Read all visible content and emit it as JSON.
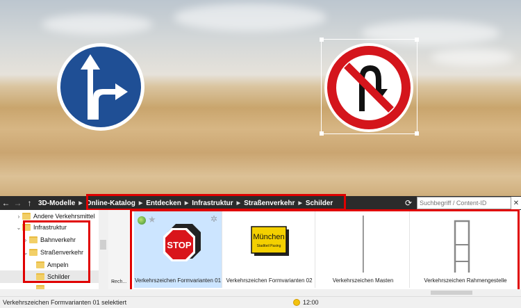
{
  "toolbar": {
    "root_label": "3D-Modelle",
    "breadcrumbs": [
      "Online-Katalog",
      "Entdecken",
      "Infrastruktur",
      "Straßenverkehr",
      "Schilder"
    ],
    "search_placeholder": "Suchbegriff / Content-ID"
  },
  "tree": {
    "items": [
      {
        "label": "Andere Verkehrsmittel",
        "expanded": false
      },
      {
        "label": "Infrastruktur",
        "expanded": true
      },
      {
        "label": "Bahnverkehr",
        "expanded": false
      },
      {
        "label": "Straßenverkehr",
        "expanded": true
      },
      {
        "label": "Ampeln",
        "expanded": false
      },
      {
        "label": "Schilder",
        "selected": true
      },
      {
        "label": "..."
      }
    ],
    "column_label": "Rech..."
  },
  "catalog": {
    "items": [
      {
        "label": "Verkehrszeichen Formvarianten 01",
        "icon": "stop-sign-icon",
        "selected": true
      },
      {
        "label": "Verkehrszeichen Formvarianten 02",
        "icon": "town-sign-icon",
        "sign_text_1": "München",
        "sign_text_2": "Stadtteil Pasing"
      },
      {
        "label": "Verkehrszeichen Masten",
        "icon": "pole-icon"
      },
      {
        "label": "Verkehrszeichen Rahmengestelle",
        "icon": "frame-icon"
      }
    ],
    "stop_text": "STOP"
  },
  "status": {
    "selection_text": "Verkehrszeichen Formvarianten 01 selektiert",
    "time": "12:00"
  },
  "colors": {
    "highlight": "#e00000",
    "sign_blue": "#1f4f95",
    "sign_red": "#d4151c",
    "toolbar_bg": "#2b2b2b",
    "selected_tile": "#cce5ff"
  }
}
